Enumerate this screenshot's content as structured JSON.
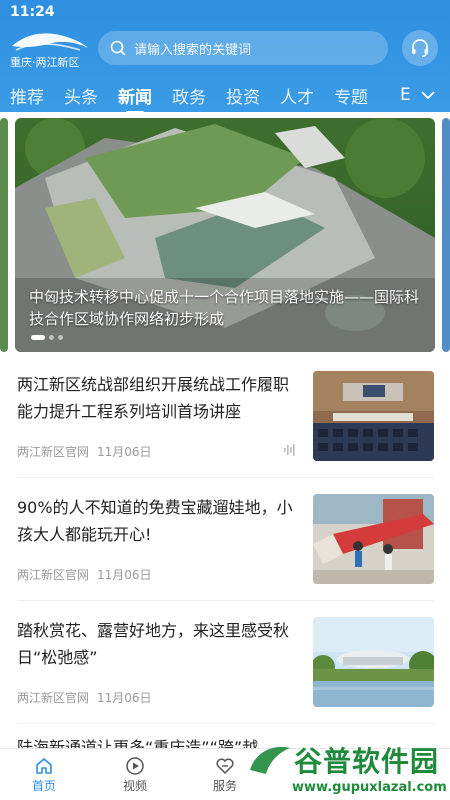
{
  "status_bar": {
    "time": "11:24"
  },
  "header": {
    "logo_text": "重庆·两江新区",
    "search_placeholder": "请输入搜索的关键词"
  },
  "tabs": [
    {
      "label": "推荐",
      "active": false
    },
    {
      "label": "头条",
      "active": false
    },
    {
      "label": "新闻",
      "active": true
    },
    {
      "label": "政务",
      "active": false
    },
    {
      "label": "投资",
      "active": false
    },
    {
      "label": "人才",
      "active": false
    },
    {
      "label": "专题",
      "active": false
    }
  ],
  "tab_more": "E",
  "banner": {
    "caption": "中匈技术转移中心促成十一个合作项目落地实施——国际科技合作区域协作网络初步形成",
    "slide_count": 3,
    "active_slide": 1
  },
  "news": [
    {
      "title": "两江新区统战部组织开展统战工作履职能力提升工程系列培训首场讲座",
      "source": "两江新区官网",
      "date": "11月06日",
      "has_audio": true
    },
    {
      "title": "90%的人不知道的免费宝藏遛娃地，小孩大人都能玩开心!",
      "source": "两江新区官网",
      "date": "11月06日",
      "has_audio": false
    },
    {
      "title": "踏秋赏花、露营好地方，来这里感受秋日“松弛感”",
      "source": "两江新区官网",
      "date": "11月06日",
      "has_audio": false
    },
    {
      "title": "陆海新通道让更多“重庆造”“跨”越",
      "source": "",
      "date": "",
      "has_audio": false
    }
  ],
  "bottom_nav": [
    {
      "label": "首页",
      "icon": "home-icon",
      "active": true
    },
    {
      "label": "视频",
      "icon": "play-circle-icon",
      "active": false
    },
    {
      "label": "服务",
      "icon": "service-icon",
      "active": false
    }
  ],
  "watermark": {
    "title": "谷普软件园",
    "url": "www.gupuxlazal.com"
  },
  "colors": {
    "primary": "#2f8fe0",
    "text": "#222222",
    "meta": "#999999",
    "watermark": "#1f8a3b"
  }
}
